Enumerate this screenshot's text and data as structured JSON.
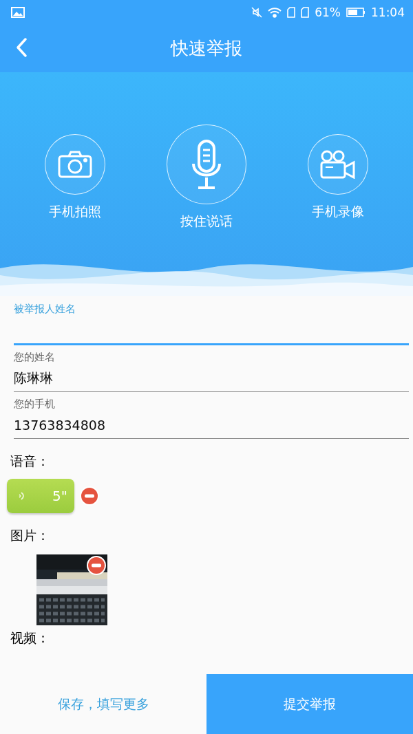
{
  "status_bar": {
    "battery": "61%",
    "time": "11:04"
  },
  "header": {
    "title": "快速举报"
  },
  "actions": [
    {
      "kind": "camera",
      "label": "手机拍照"
    },
    {
      "kind": "mic",
      "label": "按住说话"
    },
    {
      "kind": "video",
      "label": "手机录像"
    }
  ],
  "fields": [
    {
      "label": "被举报人姓名",
      "focused": true
    },
    {
      "label": "您的姓名",
      "value": "陈琳琳",
      "focused": false
    },
    {
      "label": "您的手机",
      "value": "13763834808",
      "focused": false
    }
  ],
  "voice": {
    "label": "语音：",
    "duration": "5\""
  },
  "images": {
    "label": "图片："
  },
  "video": {
    "label": "视频："
  },
  "footer": {
    "save": "保存，填写更多",
    "submit": "提交举报"
  }
}
